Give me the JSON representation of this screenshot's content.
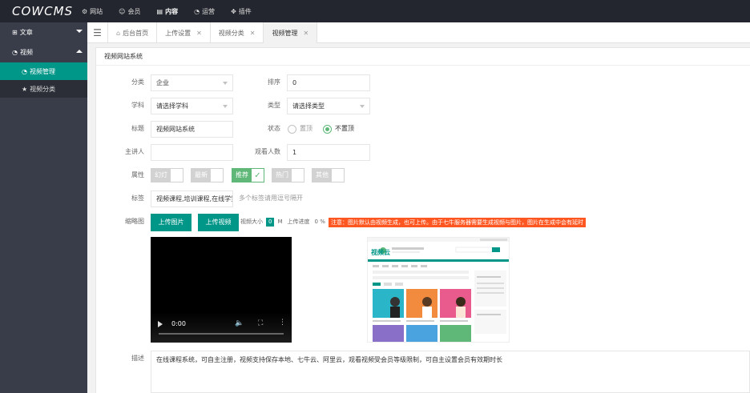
{
  "app": {
    "logo": "COWCMS"
  },
  "topnav": [
    {
      "icon": "gear-icon",
      "glyph": "⚙",
      "label": "网站"
    },
    {
      "icon": "user-icon",
      "glyph": "☺",
      "label": "会员"
    },
    {
      "icon": "content-icon",
      "glyph": "▤",
      "label": "内容"
    },
    {
      "icon": "gauge-icon",
      "glyph": "◔",
      "label": "运营"
    },
    {
      "icon": "plugin-icon",
      "glyph": "✥",
      "label": "插件"
    }
  ],
  "sidebar": {
    "articles": {
      "icon": "book-icon",
      "glyph": "⊞",
      "label": "文章"
    },
    "video": {
      "icon": "dashboard-icon",
      "glyph": "◔",
      "label": "视频"
    },
    "sub": [
      {
        "glyph": "◔",
        "label": "视频管理"
      },
      {
        "glyph": "★",
        "label": "视频分类"
      }
    ]
  },
  "tabs": [
    {
      "label": "后台首页",
      "glyph": "⌂"
    },
    {
      "label": "上传设置",
      "close": "✕"
    },
    {
      "label": "视频分类",
      "close": "✕"
    },
    {
      "label": "视频管理",
      "close": "✕"
    }
  ],
  "panel": {
    "title": "视频网站系统"
  },
  "form": {
    "category": {
      "label": "分类",
      "value": "企业"
    },
    "sort": {
      "label": "排序",
      "value": "0"
    },
    "subject": {
      "label": "学科",
      "value": "请选择学科"
    },
    "type": {
      "label": "类型",
      "value": "请选择类型"
    },
    "title": {
      "label": "标题",
      "value": "视频网站系统"
    },
    "status": {
      "label": "状态",
      "options": [
        "置顶",
        "不置顶"
      ]
    },
    "speaker": {
      "label": "主讲人",
      "value": ""
    },
    "views": {
      "label": "观看人数",
      "value": "1"
    },
    "attrs": {
      "label": "属性",
      "items": [
        "幻灯",
        "最新",
        "推荐",
        "热门",
        "其他"
      ],
      "check": "✓"
    },
    "tags": {
      "label": "标签",
      "value": "视频课程,培训课程,在线学堂",
      "hint": "多个标签请用逗号隔开"
    },
    "thumb": {
      "label": "缩略图"
    },
    "upload_image": "上传图片",
    "upload_video": "上传视频",
    "video_size_label": "视频大小",
    "video_size_value": "0",
    "video_size_unit": "M",
    "progress_label": "上传进度",
    "progress_value": "0 %",
    "notice": "注意：图片默认由视频生成，也可上传。由于七牛服务器需要生成视频与图片，图片在生成中会有延时",
    "desc": {
      "label": "描述",
      "value": "在线课程系统，可自主注册，视频支持保存本地、七牛云、阿里云，观看视频受会员等级限制，可自主设置会员有效期时长"
    }
  },
  "player": {
    "time": "0:00",
    "volume_glyph": "🔈",
    "fullscreen_glyph": "⛶",
    "more_glyph": "⋮"
  },
  "preview": {
    "logo": "视频云",
    "cards": [
      {
        "color": "#2bb5c9",
        "caption": "线上教学 大师精讲"
      },
      {
        "color": "#f28b3d",
        "caption": "名师直播"
      },
      {
        "color": "#e85b8c",
        "caption": "精品课程"
      }
    ]
  }
}
